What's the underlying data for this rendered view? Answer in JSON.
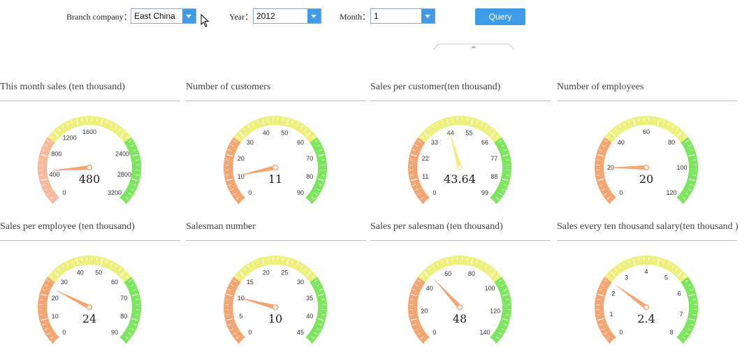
{
  "filters": {
    "branch_label": "Branch company：",
    "branch_value": "East China",
    "year_label": "Year：",
    "year_value": "2012",
    "month_label": "Month：",
    "month_value": "1",
    "query_label": "Query"
  },
  "colors": {
    "low": "#f4a571",
    "mid": "#eef07e",
    "high": "#7ce75d",
    "needle": "#f4a571",
    "needle_alt": "#eeee80"
  },
  "gauges": [
    {
      "title": "This month sales (ten thousand)",
      "value": 480,
      "display": "480",
      "ticks": [
        "0",
        "400",
        "800",
        "1200",
        "1600",
        "2400",
        "2800",
        "3200"
      ],
      "tick_values": [
        0,
        400,
        800,
        1200,
        1600,
        2400,
        2800,
        3200
      ],
      "min": 0,
      "max": 3200,
      "needle": "low",
      "pale_low": true
    },
    {
      "title": "Number of customers",
      "value": 11,
      "display": "11",
      "ticks": [
        "0",
        "10",
        "20",
        "30",
        "40",
        "50",
        "60",
        "70",
        "80",
        "90"
      ],
      "tick_values": [
        0,
        10,
        20,
        30,
        40,
        50,
        60,
        70,
        80,
        90
      ],
      "min": 0,
      "max": 90,
      "needle": "low"
    },
    {
      "title": "Sales per customer(ten thousand)",
      "value": 43.64,
      "display": "43.64",
      "ticks": [
        "0",
        "11",
        "22",
        "33",
        "44",
        "55",
        "66",
        "77",
        "88",
        "99"
      ],
      "tick_values": [
        0,
        11,
        22,
        33,
        44,
        55,
        66,
        77,
        88,
        99
      ],
      "min": 0,
      "max": 99,
      "needle": "mid"
    },
    {
      "title": "Number of employees",
      "value": 20,
      "display": "20",
      "ticks": [
        "0",
        "20",
        "40",
        "60",
        "80",
        "100",
        "120"
      ],
      "tick_values": [
        0,
        20,
        40,
        60,
        80,
        100,
        120
      ],
      "min": 0,
      "max": 120,
      "needle": "low"
    },
    {
      "title": "Sales per employee (ten thousand)",
      "value": 24,
      "display": "24",
      "ticks": [
        "0",
        "10",
        "20",
        "30",
        "40",
        "50",
        "60",
        "70",
        "80",
        "90"
      ],
      "tick_values": [
        0,
        10,
        20,
        30,
        40,
        50,
        60,
        70,
        80,
        90
      ],
      "min": 0,
      "max": 90,
      "needle": "low"
    },
    {
      "title": "Salesman number",
      "value": 10,
      "display": "10",
      "ticks": [
        "0",
        "5",
        "10",
        "15",
        "20",
        "25",
        "30",
        "35",
        "40",
        "45"
      ],
      "tick_values": [
        0,
        5,
        10,
        15,
        20,
        25,
        30,
        35,
        40,
        45
      ],
      "min": 0,
      "max": 45,
      "needle": "low"
    },
    {
      "title": "Sales per salesman (ten thousand)",
      "value": 48,
      "display": "48",
      "ticks": [
        "0",
        "20",
        "40",
        "60",
        "80",
        "100",
        "120",
        "140"
      ],
      "tick_values": [
        0,
        20,
        40,
        60,
        80,
        100,
        120,
        140
      ],
      "min": 0,
      "max": 140,
      "needle": "low"
    },
    {
      "title": "Sales every ten thousand salary(ten thousand )",
      "value": 2.4,
      "display": "2.4",
      "ticks": [
        "0",
        "1",
        "2",
        "3",
        "4",
        "5",
        "6",
        "7",
        "8"
      ],
      "tick_values": [
        0,
        1,
        2,
        3,
        4,
        5,
        6,
        7,
        8
      ],
      "min": 0,
      "max": 8,
      "needle": "low"
    }
  ]
}
